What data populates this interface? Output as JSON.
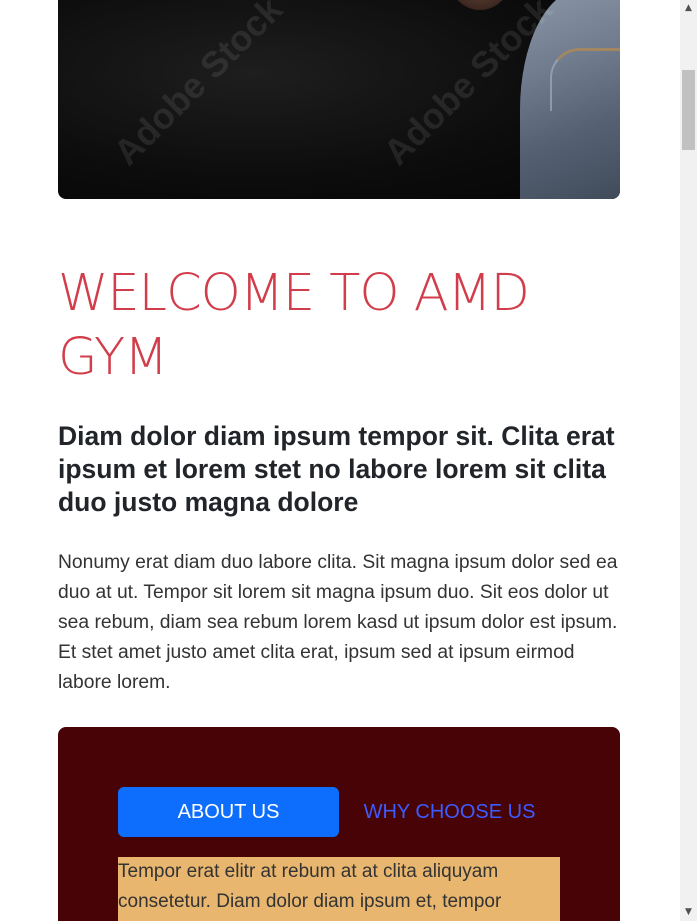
{
  "hero": {
    "watermark_text": "Adobe Stock"
  },
  "welcome": {
    "title": "WELCOME TO AMD GYM",
    "subtitle": "Diam dolor diam ipsum tempor sit. Clita erat ipsum et lorem stet no labore lorem sit clita duo justo magna dolore",
    "body": "Nonumy erat diam duo labore clita. Sit magna ipsum dolor sed ea duo at ut. Tempor sit lorem sit magna ipsum duo. Sit eos dolor ut sea rebum, diam sea rebum lorem kasd ut ipsum dolor est ipsum. Et stet amet justo amet clita erat, ipsum sed at ipsum eirmod labore lorem."
  },
  "tabs": {
    "about_label": "ABOUT US",
    "why_label": "WHY CHOOSE US",
    "active": "about",
    "content": "Tempor erat elitr at rebum at at clita aliquyam consetetur. Diam dolor diam ipsum et, tempor"
  },
  "colors": {
    "title": "#d13d4a",
    "panel": "#480307",
    "active_tab": "#0d6efd",
    "inactive_tab_text": "#3b5cff",
    "content_bg": "#e8b66f"
  },
  "scrollbar": {
    "up_icon": "triangle-up-icon",
    "down_icon": "triangle-down-icon"
  }
}
